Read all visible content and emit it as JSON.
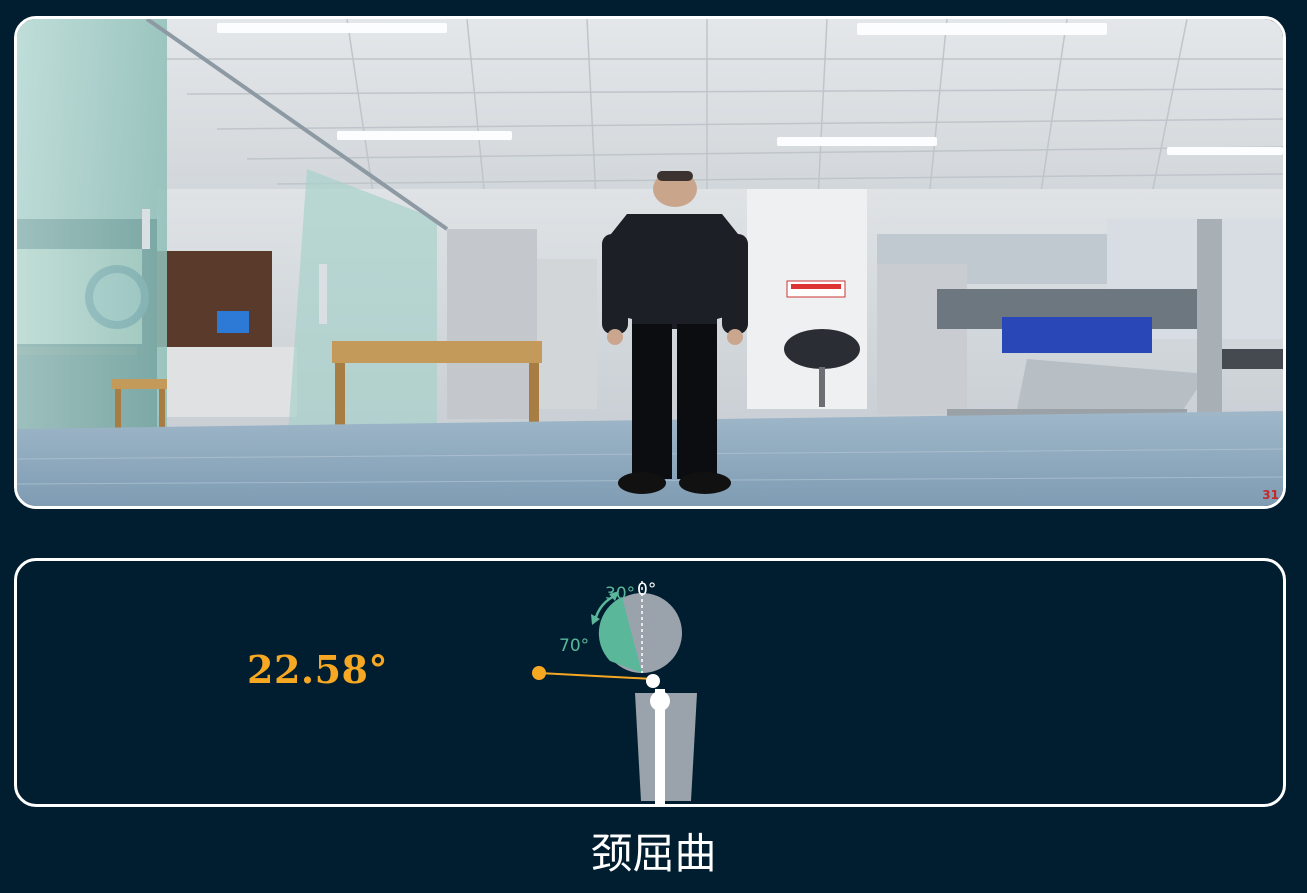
{
  "camera": {
    "frame_counter": "31"
  },
  "measurement": {
    "angle_value": "22.58°",
    "diagram": {
      "label_start": "30°",
      "label_zero": "0°",
      "label_end": "70°"
    }
  },
  "exercise": {
    "title": "颈屈曲"
  },
  "colors": {
    "background": "#011e30",
    "border": "#ffffff",
    "angle_text": "#f7a823",
    "range_fill": "#5bb79a",
    "head_fill": "#9aa3ab"
  }
}
